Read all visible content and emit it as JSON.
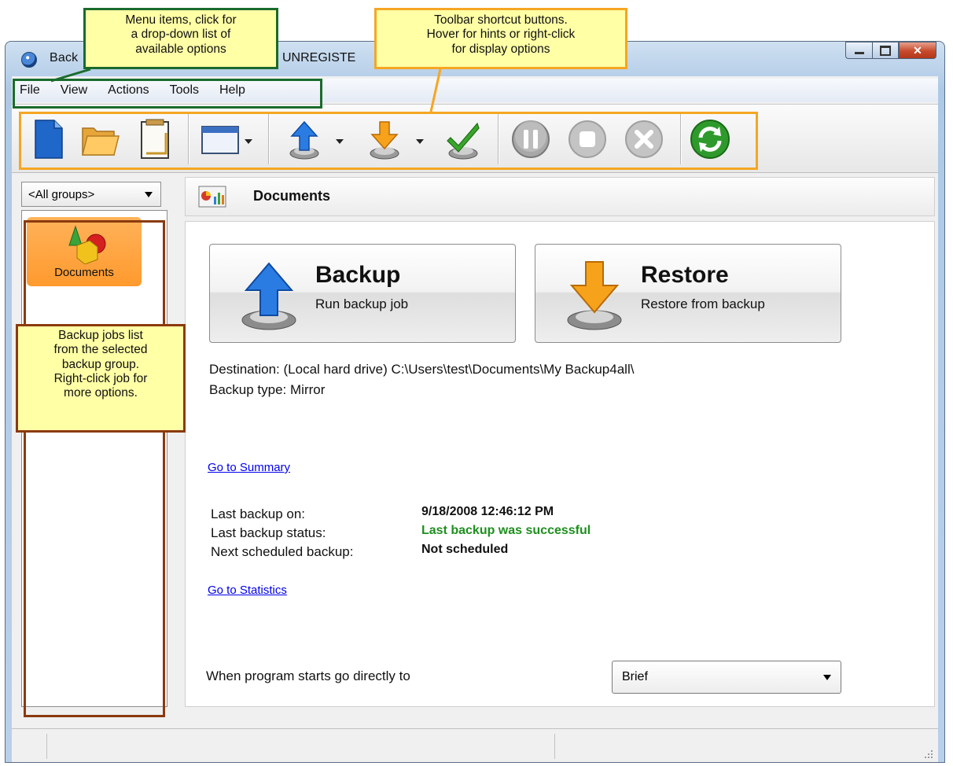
{
  "window": {
    "title_start": "Back",
    "title_end": "UNREGISTE"
  },
  "menu": [
    "File",
    "View",
    "Actions",
    "Tools",
    "Help"
  ],
  "toolbar_icons": [
    "new-job-icon",
    "open-job-icon",
    "properties-icon",
    "view-layout-icon",
    "backup-icon",
    "restore-icon",
    "test-icon",
    "pause-icon",
    "stop-icon",
    "cancel-icon",
    "refresh-icon"
  ],
  "sidebar": {
    "group_select": "<All groups>",
    "job_label": "Documents"
  },
  "header": {
    "title": "Documents"
  },
  "backup_button": {
    "title": "Backup",
    "subtitle": "Run backup job"
  },
  "restore_button": {
    "title": "Restore",
    "subtitle": "Restore from backup"
  },
  "info": {
    "destination": "Destination: (Local hard drive) C:\\Users\\test\\Documents\\My Backup4all\\",
    "backup_type": "Backup type: Mirror"
  },
  "links": {
    "summary": "Go to Summary",
    "statistics": "Go to Statistics"
  },
  "status": {
    "last_backup_label": "Last backup on:",
    "last_backup_value": "9/18/2008 12:46:12 PM",
    "last_status_label": "Last backup status:",
    "last_status_value": "Last backup was successful",
    "next_label": "Next scheduled backup:",
    "next_value": "Not scheduled"
  },
  "startup": {
    "label": "When program starts go directly to",
    "selected": "Brief"
  },
  "annotations": {
    "menu_line1": "Menu items, click for",
    "menu_line2": "a drop-down list of",
    "menu_line3": "available options",
    "toolbar_line1": "Toolbar shortcut buttons.",
    "toolbar_line2": "Hover for hints or right-click",
    "toolbar_line3": "for display options",
    "jobs_line1": "Backup jobs list",
    "jobs_line2": "from the selected",
    "jobs_line3": "backup group.",
    "jobs_line4": "Right-click job for",
    "jobs_line5": "more options."
  },
  "colors": {
    "success_green": "#1e8f1e",
    "link_blue": "#0000ee",
    "callout_yellow": "#ffffa6",
    "menu_callout_border": "#1a6b2c",
    "toolbar_callout_border": "#f5a623",
    "jobs_callout_border": "#8b3a0e"
  }
}
